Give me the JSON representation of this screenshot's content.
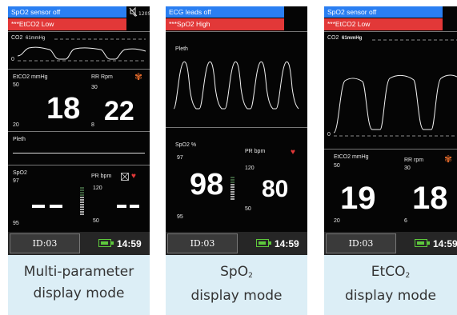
{
  "colors": {
    "alarm_blue": "#2a7ff2",
    "alarm_red": "#e23838",
    "caption_bg": "#dceef6",
    "battery_green": "#5ec93c"
  },
  "panels": [
    {
      "caption_line1": "Multi-parameter",
      "caption_line2": "display mode",
      "alarm_blue": "SpO2 sensor off",
      "alarm_red": "***EtCO2 Low",
      "co2_label": "CO2",
      "co2_unit": "61mmHg",
      "co2_scale_top": "",
      "co2_scale_zero": "0",
      "etco2_label": "EtCO2 mmHg",
      "etco2_high": "50",
      "etco2_value": "18",
      "etco2_low": "20",
      "rr_label": "RR Rpm",
      "rr_high": "30",
      "rr_value": "22",
      "rr_low": "8",
      "pleth_label": "Pleth",
      "spo2_label": "SpO2",
      "spo2_high": "97",
      "spo2_value": "--",
      "spo2_low": "95",
      "pr_label": "PR bpm",
      "pr_high": "120",
      "pr_value": "--",
      "pr_low": "50",
      "device_id": "ID:03",
      "time": "14:59",
      "icons": [
        "alarm-mute-icon",
        "lung-icon",
        "heart-icon",
        "battery-icon"
      ]
    },
    {
      "caption_line1": "SpO",
      "caption_sub": "2",
      "caption_line2": "display mode",
      "alarm_blue": "ECG leads off",
      "alarm_red": "***SpO2 High",
      "pleth_label": "Pleth",
      "spo2_label": "SpO2 %",
      "spo2_high": "97",
      "spo2_value": "98",
      "spo2_low": "95",
      "pr_label": "PR bpm",
      "pr_high": "120",
      "pr_value": "80",
      "pr_low": "50",
      "device_id": "ID:03",
      "time": "14:59",
      "icons": [
        "heart-icon",
        "battery-icon"
      ]
    },
    {
      "caption_line1": "EtCO",
      "caption_sub": "2",
      "caption_line2": "display mode",
      "alarm_blue": "SpO2 sensor off",
      "alarm_red": "***EtCO2 Low",
      "co2_label": "CO2",
      "co2_unit": "61mmHg",
      "co2_scale_zero": "0",
      "etco2_label": "EtCO2 mmHg",
      "etco2_high": "50",
      "etco2_value": "19",
      "etco2_low": "20",
      "rr_label": "RR rpm",
      "rr_high": "30",
      "rr_value": "18",
      "rr_low": "6",
      "device_id": "ID:03",
      "time": "14:59",
      "icons": [
        "lung-icon",
        "battery-icon"
      ]
    }
  ]
}
